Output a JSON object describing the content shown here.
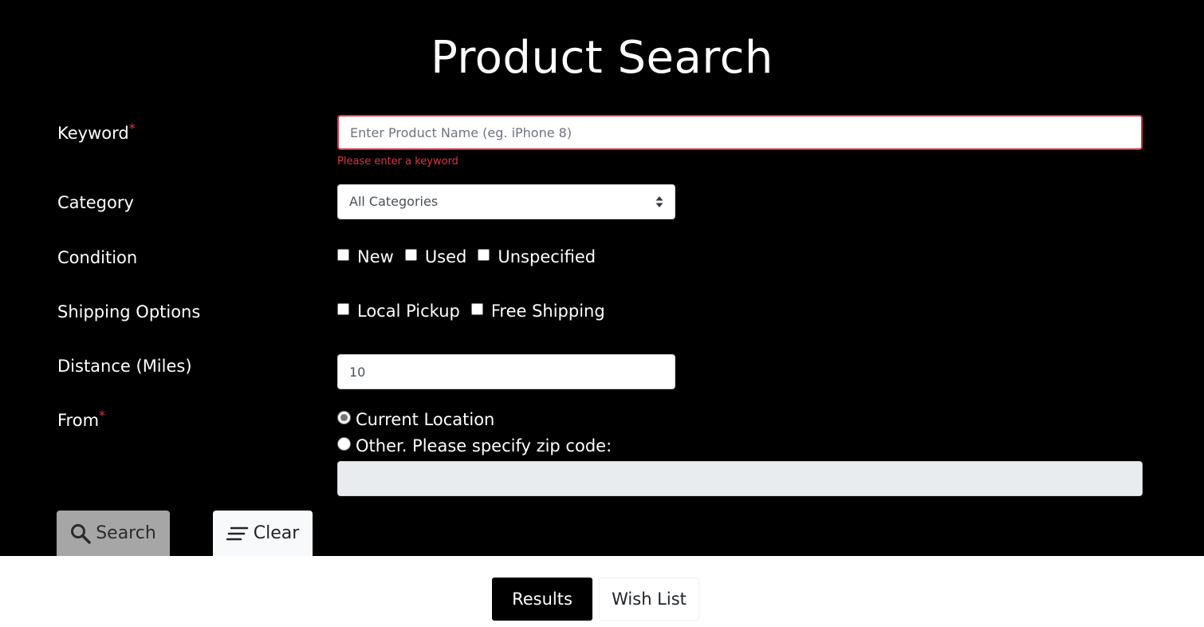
{
  "title": "Product Search",
  "required_marker": "*",
  "keyword": {
    "label": "Keyword",
    "placeholder": "Enter Product Name (eg. iPhone 8)",
    "value": "",
    "error": "Please enter a keyword"
  },
  "category": {
    "label": "Category",
    "selected": "All Categories"
  },
  "condition": {
    "label": "Condition",
    "options": [
      "New",
      "Used",
      "Unspecified"
    ]
  },
  "shipping": {
    "label": "Shipping Options",
    "options": [
      "Local Pickup",
      "Free Shipping"
    ]
  },
  "distance": {
    "label": "Distance (Miles)",
    "value": "10"
  },
  "from": {
    "label": "From",
    "current_location": "Current Location",
    "other": "Other. Please specify zip code:",
    "zip_value": ""
  },
  "buttons": {
    "search": "Search",
    "clear": "Clear"
  },
  "tabs": {
    "results": "Results",
    "wishlist": "Wish List"
  },
  "colors": {
    "panel_bg": "#000000",
    "error": "#dc3545",
    "search_btn": "#a6a6a6"
  }
}
